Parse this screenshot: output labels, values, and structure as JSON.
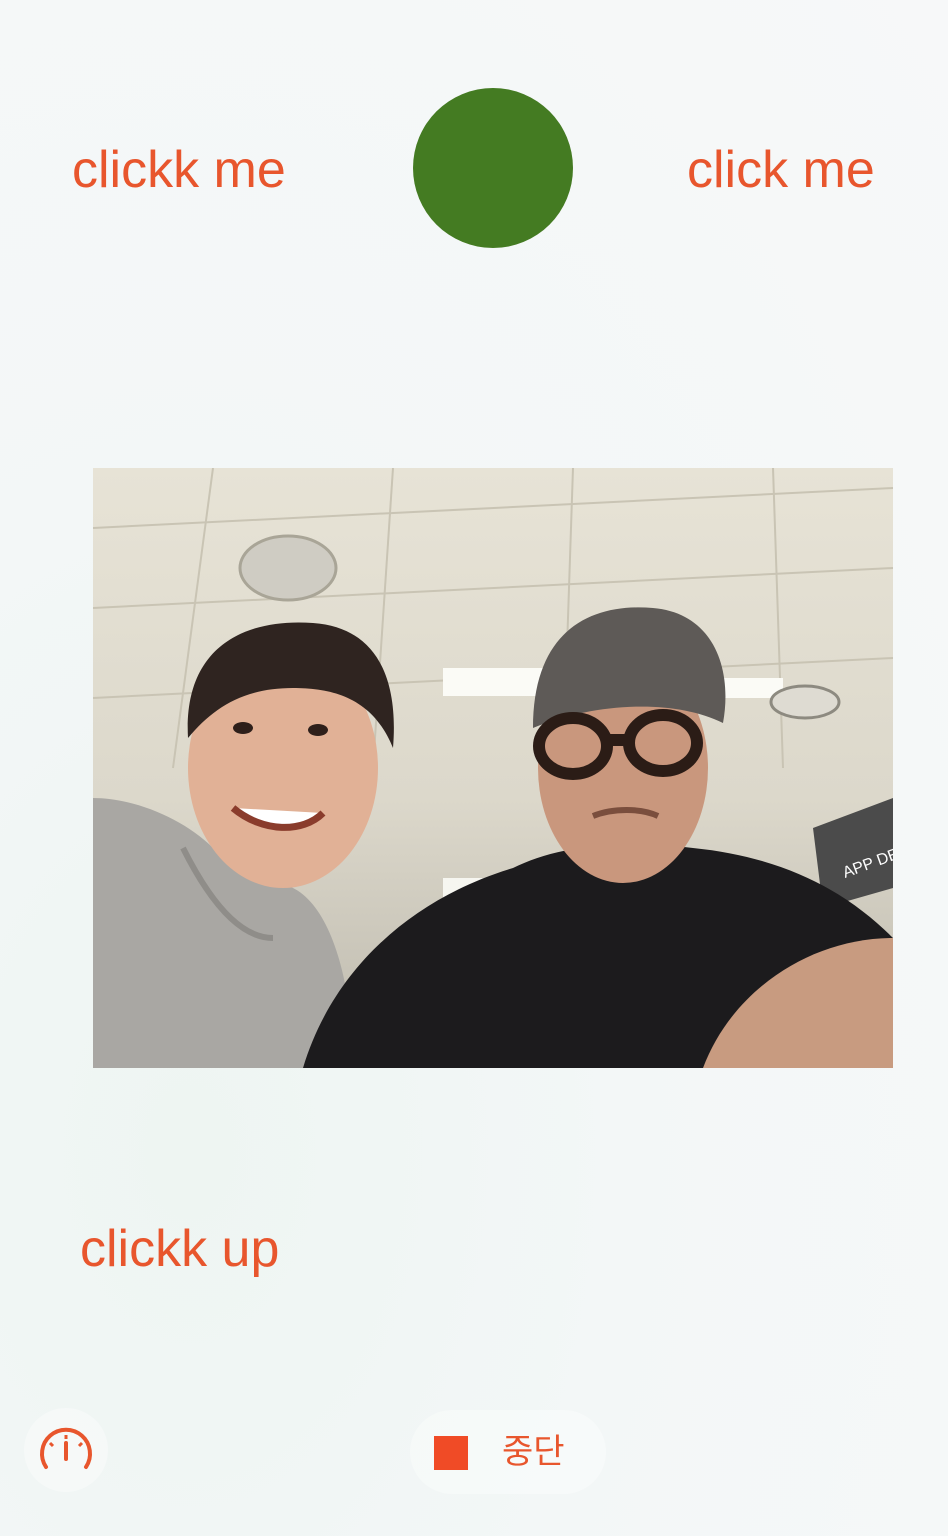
{
  "buttons": {
    "top_left": "clickk me",
    "top_right": "click me",
    "bottom": "clickk up"
  },
  "toolbar": {
    "stop_label": "중단",
    "gauge_icon": "speedometer-icon",
    "stop_icon": "stop-square-icon"
  },
  "photo": {
    "sign_text": "APP DEV"
  },
  "colors": {
    "accent": "#e8562d",
    "circle": "#447b22",
    "stop": "#f04b26"
  }
}
